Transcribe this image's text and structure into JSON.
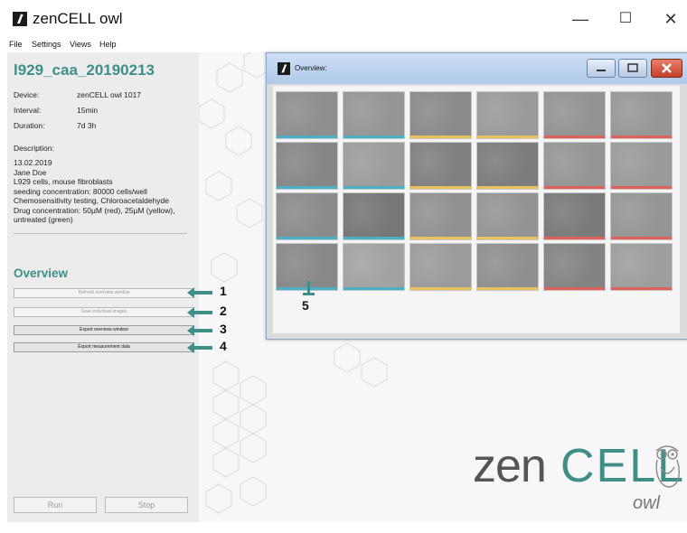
{
  "app": {
    "title": "zenCELL owl"
  },
  "window_controls": {
    "minimize": "—",
    "maximize": "☐",
    "close": "✕"
  },
  "menu": [
    "File",
    "Settings",
    "Views",
    "Help"
  ],
  "experiment": {
    "title": "l929_caa_20190213",
    "device_label": "Device:",
    "device_value": "zenCELL owl 1017",
    "interval_label": "Interval:",
    "interval_value": "15min",
    "duration_label": "Duration:",
    "duration_value": "7d 3h",
    "description_label": "Description:",
    "description": "13.02.2019\nJane Doe\nL929 cells, mouse fibroblasts\nseeding concentration: 80000 cells/well\nChemosensitivity testing, Chloroacetaldehyde\nDrug concentration: 50µM (red), 25µM (yellow),\nuntreated (green)"
  },
  "overview_panel": {
    "title": "Overview",
    "buttons": [
      {
        "label": "Refresh overview window",
        "enabled": false,
        "annotation": "1"
      },
      {
        "label": "Save individual images",
        "enabled": false,
        "annotation": "2"
      },
      {
        "label": "Export overview window",
        "enabled": true,
        "annotation": "3"
      },
      {
        "label": "Export measurement data",
        "enabled": true,
        "annotation": "4"
      }
    ]
  },
  "controls": {
    "run": "Run",
    "stop": "Stop"
  },
  "overview_window": {
    "title": "Overview:",
    "annotation": "5",
    "wells": [
      {
        "stripe": "#4ab0c4",
        "shade": "#8e8e8e"
      },
      {
        "stripe": "#4ab0c4",
        "shade": "#959595"
      },
      {
        "stripe": "#e8c25c",
        "shade": "#8a8a8a"
      },
      {
        "stripe": "#e8c25c",
        "shade": "#9a9a9a"
      },
      {
        "stripe": "#e0605a",
        "shade": "#939393"
      },
      {
        "stripe": "#e0605a",
        "shade": "#979797"
      },
      {
        "stripe": "#4ab0c4",
        "shade": "#868686"
      },
      {
        "stripe": "#4ab0c4",
        "shade": "#9c9c9c"
      },
      {
        "stripe": "#e8c25c",
        "shade": "#808080"
      },
      {
        "stripe": "#e8c25c",
        "shade": "#7c7c7c"
      },
      {
        "stripe": "#e0605a",
        "shade": "#959595"
      },
      {
        "stripe": "#e0605a",
        "shade": "#9a9a9a"
      },
      {
        "stripe": "#4ab0c4",
        "shade": "#8b8b8b"
      },
      {
        "stripe": "#4ab0c4",
        "shade": "#777777"
      },
      {
        "stripe": "#e8c25c",
        "shade": "#919191"
      },
      {
        "stripe": "#e8c25c",
        "shade": "#949494"
      },
      {
        "stripe": "#e0605a",
        "shade": "#7a7a7a"
      },
      {
        "stripe": "#e0605a",
        "shade": "#959595"
      },
      {
        "stripe": "#4ab0c4",
        "shade": "#888888"
      },
      {
        "stripe": "#4ab0c4",
        "shade": "#a2a2a2"
      },
      {
        "stripe": "#e8c25c",
        "shade": "#9b9b9b"
      },
      {
        "stripe": "#e8c25c",
        "shade": "#8f8f8f"
      },
      {
        "stripe": "#e0605a",
        "shade": "#838383"
      },
      {
        "stripe": "#e0605a",
        "shade": "#9e9e9e"
      }
    ]
  },
  "brand": {
    "zen": "zen",
    "cell": "CELL",
    "owl": "owl"
  },
  "colors": {
    "accent": "#3f8f86",
    "untreated": "#4ab0c4",
    "medium_dose": "#e8c25c",
    "high_dose": "#e0605a"
  }
}
